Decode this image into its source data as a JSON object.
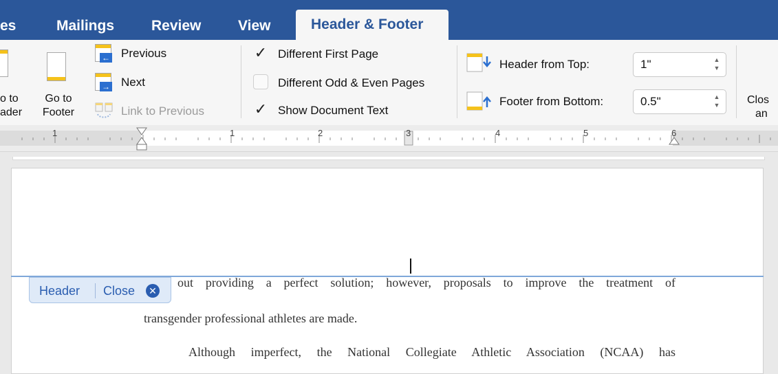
{
  "tabs": [
    {
      "label": "es",
      "active": false
    },
    {
      "label": "Mailings",
      "active": false
    },
    {
      "label": "Review",
      "active": false
    },
    {
      "label": "View",
      "active": false
    },
    {
      "label": "Header & Footer",
      "active": true
    }
  ],
  "ribbon": {
    "go_to_header": {
      "line1": "o to",
      "line2": "ader"
    },
    "go_to_footer": {
      "line1": "Go to",
      "line2": "Footer"
    },
    "previous": "Previous",
    "next": "Next",
    "link_to_previous": "Link to Previous",
    "options": [
      {
        "label": "Different First Page",
        "checked": true
      },
      {
        "label": "Different Odd & Even Pages",
        "checked": false
      },
      {
        "label": "Show Document Text",
        "checked": true
      }
    ],
    "header_from_top": {
      "label": "Header from Top:",
      "value": "1\""
    },
    "footer_from_bottom": {
      "label": "Footer from Bottom:",
      "value": "0.5\""
    },
    "close_partial": {
      "line1": "Clos",
      "line2": "an"
    }
  },
  "ruler": {
    "numbers": [
      "1",
      "1",
      "2",
      "3",
      "4",
      "5",
      "6"
    ]
  },
  "document": {
    "header_tag": {
      "label": "Header",
      "close": "Close"
    },
    "lines": [
      "out providing a perfect solution; however, proposals to improve the treatment of",
      "transgender professional athletes are made.",
      "Although imperfect, the National Collegiate Athletic Association (NCAA) has"
    ]
  },
  "colors": {
    "accent": "#2b579a",
    "tag_blue": "#2a5db0",
    "page_icon_yellow": "#f5c21b"
  },
  "icons": [
    "page-header-icon",
    "page-footer-icon",
    "previous-icon",
    "next-icon",
    "link-icon",
    "checkmark-icon",
    "arrow-down-icon",
    "arrow-up-icon",
    "close-circle-icon"
  ]
}
